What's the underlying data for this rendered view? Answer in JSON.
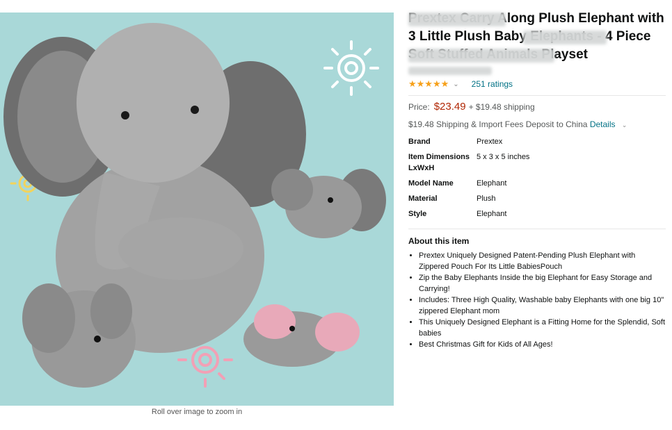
{
  "product": {
    "title": "Prextex Carry Along Plush Elephant with 3 Little Plush Baby Elephants - 4 Piece Soft Stuffed Animals Playset",
    "rating_stars": "★★★★★",
    "ratings_count": "251 ratings",
    "price_label": "Price:",
    "price": "$23.49",
    "shipping": "+ $19.48 shipping",
    "import_fees": "$19.48 Shipping & Import Fees Deposit to China",
    "details_link": "Details",
    "zoom_hint": "Roll over image to zoom in"
  },
  "specs": [
    {
      "key": "Brand",
      "value": "Prextex"
    },
    {
      "key": "Item Dimensions LxWxH",
      "value": "5 x 3 x 5 inches"
    },
    {
      "key": "Model Name",
      "value": "Elephant"
    },
    {
      "key": "Material",
      "value": "Plush"
    },
    {
      "key": "Style",
      "value": "Elephant"
    }
  ],
  "about": {
    "title": "About this item",
    "bullets": [
      "Prextex Uniquely Designed Patent-Pending Plush Elephant with Zippered Pouch For Its Little BabiesPouch",
      "Zip the Baby Elephants Inside the big Elephant for Easy Storage and Carrying!",
      "Includes: Three High Quality, Washable baby Elephants with one big 10\" zippered Elephant mom",
      "This Uniquely Designed Elephant is a Fitting Home for the Splendid, Soft babies",
      "Best Christmas Gift for Kids of All Ages!"
    ]
  },
  "colors": {
    "image_bg": "#a9d8d8",
    "price": "#b12704",
    "link": "#007185",
    "star": "#f6a01a"
  },
  "icons": [
    "star-icon",
    "chevron-down-icon",
    "sun-swirl-icon"
  ]
}
